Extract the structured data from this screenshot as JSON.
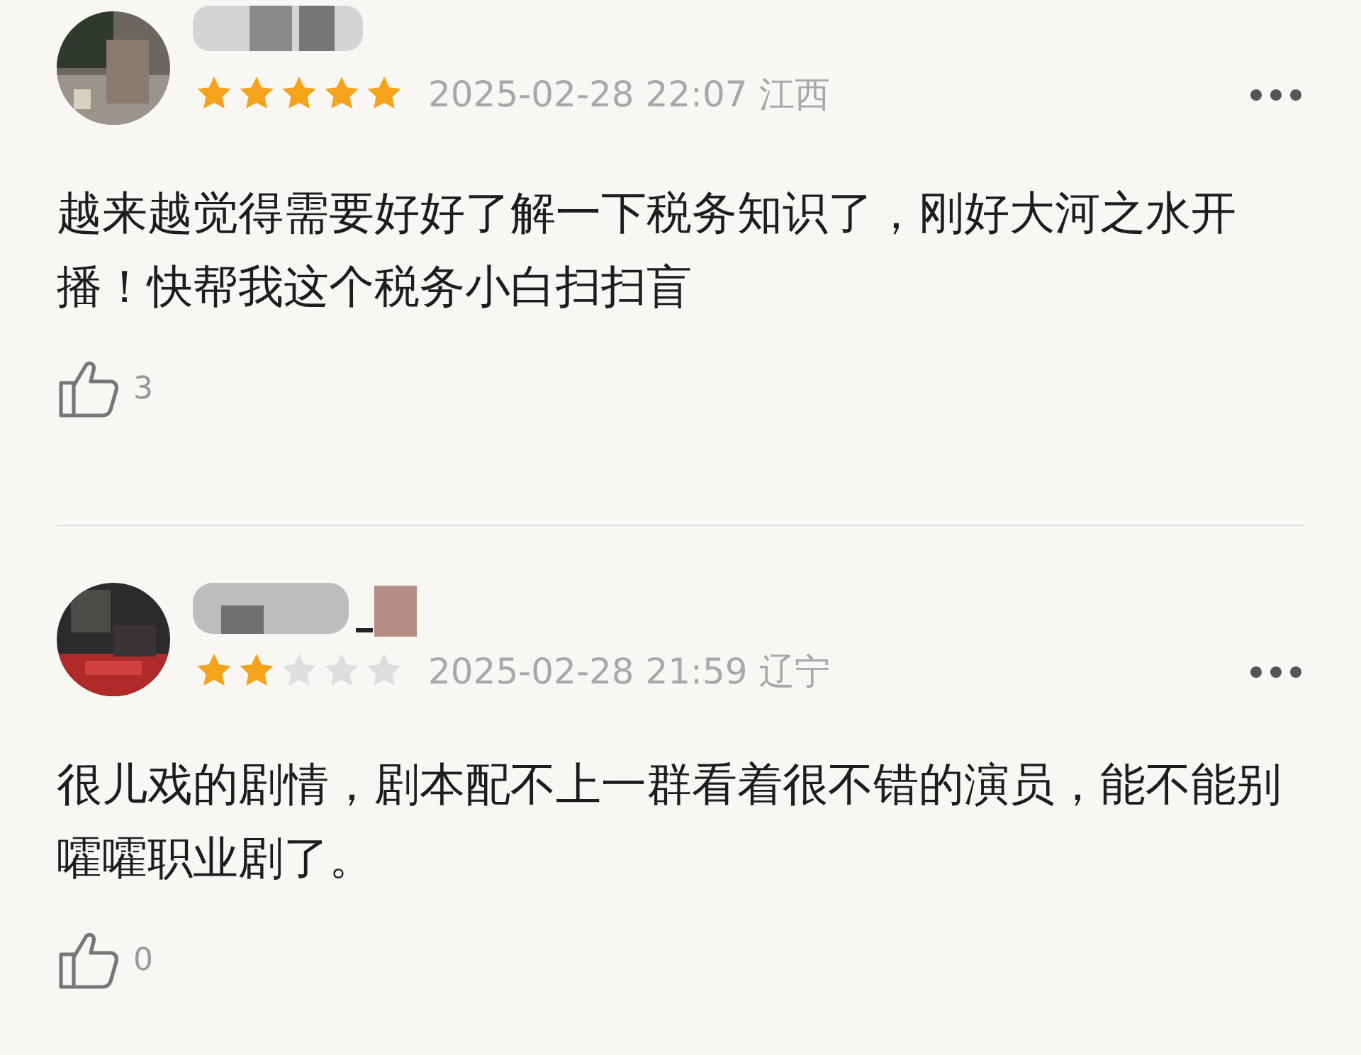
{
  "reviews": [
    {
      "stars": 5,
      "time": "2025-02-28 22:07",
      "location": "江西",
      "text": "越来越觉得需要好好了解一下税务知识了，刚好大河之水开播！快帮我这个税务小白扫扫盲",
      "likes": "3"
    },
    {
      "stars": 2,
      "time": "2025-02-28 21:59",
      "location": "辽宁",
      "text": "很儿戏的剧情，剧本配不上一群看着很不错的演员，能不能别嚯嚯职业剧了。",
      "likes": "0"
    }
  ]
}
